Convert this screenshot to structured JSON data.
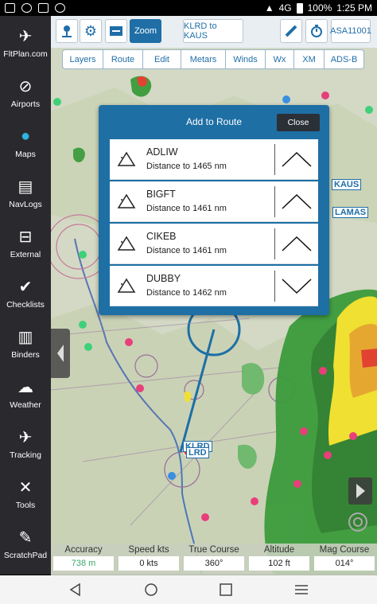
{
  "status_bar": {
    "battery": "100%",
    "time": "1:25 PM",
    "network": "4G"
  },
  "sidebar": {
    "items": [
      {
        "label": "FltPlan.com",
        "icon": "globe-plane-icon"
      },
      {
        "label": "Airports",
        "icon": "runway-icon"
      },
      {
        "label": "Maps",
        "icon": "globe-icon"
      },
      {
        "label": "NavLogs",
        "icon": "document-icon"
      },
      {
        "label": "External",
        "icon": "router-icon"
      },
      {
        "label": "Checklists",
        "icon": "checkmark-icon"
      },
      {
        "label": "Binders",
        "icon": "binder-icon"
      },
      {
        "label": "Weather",
        "icon": "rain-cloud-icon"
      },
      {
        "label": "Tracking",
        "icon": "plane-icon"
      },
      {
        "label": "Tools",
        "icon": "tools-icon"
      },
      {
        "label": "ScratchPad",
        "icon": "pencil-icon"
      }
    ]
  },
  "toolbar": {
    "zoom_label": "Zoom",
    "route_label": "KLRD to KAUS",
    "aircraft_label": "ASA11001"
  },
  "tabs": [
    "Layers",
    "Route",
    "Edit",
    "Metars",
    "Winds",
    "Wx",
    "XM",
    "ADS-B"
  ],
  "map": {
    "labels": [
      "KAUS",
      "LAMAS",
      "KLRD",
      "LRD"
    ]
  },
  "dialog": {
    "title": "Add to Route",
    "close_label": "Close",
    "waypoints": [
      {
        "name": "ADLIW",
        "distance": "Distance to 1465 nm",
        "direction": "up"
      },
      {
        "name": "BIGFT",
        "distance": "Distance to 1461 nm",
        "direction": "up"
      },
      {
        "name": "CIKEB",
        "distance": "Distance to 1461 nm",
        "direction": "up"
      },
      {
        "name": "DUBBY",
        "distance": "Distance to 1462 nm",
        "direction": "down"
      }
    ]
  },
  "info_bar": [
    {
      "label": "Accuracy",
      "value": "738 m",
      "highlight": true
    },
    {
      "label": "Speed kts",
      "value": "0 kts",
      "highlight": false
    },
    {
      "label": "True Course",
      "value": "360°",
      "highlight": false
    },
    {
      "label": "Altitude",
      "value": "102 ft",
      "highlight": false
    },
    {
      "label": "Mag Course",
      "value": "014°",
      "highlight": false
    }
  ],
  "colors": {
    "accent": "#1d6fa4",
    "sidebar_bg": "#2a2a2e",
    "active_icon": "#2fb3e0",
    "radar_green": "#3c9b3c",
    "radar_yellow": "#f2e12a",
    "radar_red": "#e33b2a",
    "waypoint_pink": "#e83f7b",
    "waypoint_green": "#3fd07a"
  }
}
